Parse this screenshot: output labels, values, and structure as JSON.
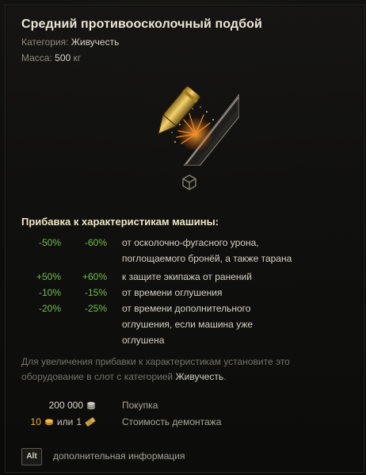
{
  "tooltip": {
    "title": "Средний противоосколочный подбой",
    "category_label": "Категория:",
    "category_value": "Живучесть",
    "mass_label": "Масса:",
    "mass_value": "500",
    "mass_unit": "кг"
  },
  "bonuses": {
    "section_title": "Прибавка к характеристикам машины:",
    "rows": [
      {
        "v1": "-50%",
        "v2": "-60%",
        "desc": "от осколочно-фугасного урона, поглощаемого бронёй, а также тарана"
      },
      {
        "v1": "+50%",
        "v2": "+60%",
        "desc": "к защите экипажа от ранений"
      },
      {
        "v1": "-10%",
        "v2": "-15%",
        "desc": "от времени оглушения"
      },
      {
        "v1": "-20%",
        "v2": "-25%",
        "desc": "от времени дополнительного оглушения, если машина уже оглушена"
      }
    ]
  },
  "hint": {
    "text": "Для увеличения прибавки к характеристикам установите это оборудование в слот с категорией",
    "category": "Живучесть",
    "end": "."
  },
  "prices": {
    "buy_value": "200 000",
    "buy_label": "Покупка",
    "demount_gold": "10",
    "demount_or": "или",
    "demount_bonds": "1",
    "demount_label": "Стоимость демонтажа"
  },
  "footer": {
    "alt_key": "Alt",
    "more_info": "дополнительная информация"
  },
  "icons": {
    "credits": "credits-icon",
    "gold": "gold-icon",
    "bond": "bond-icon",
    "cube": "3d-cube-icon"
  },
  "colors": {
    "bonus_green": "#6fc04b",
    "gold": "#f0b232",
    "title": "#ebe6d6"
  }
}
